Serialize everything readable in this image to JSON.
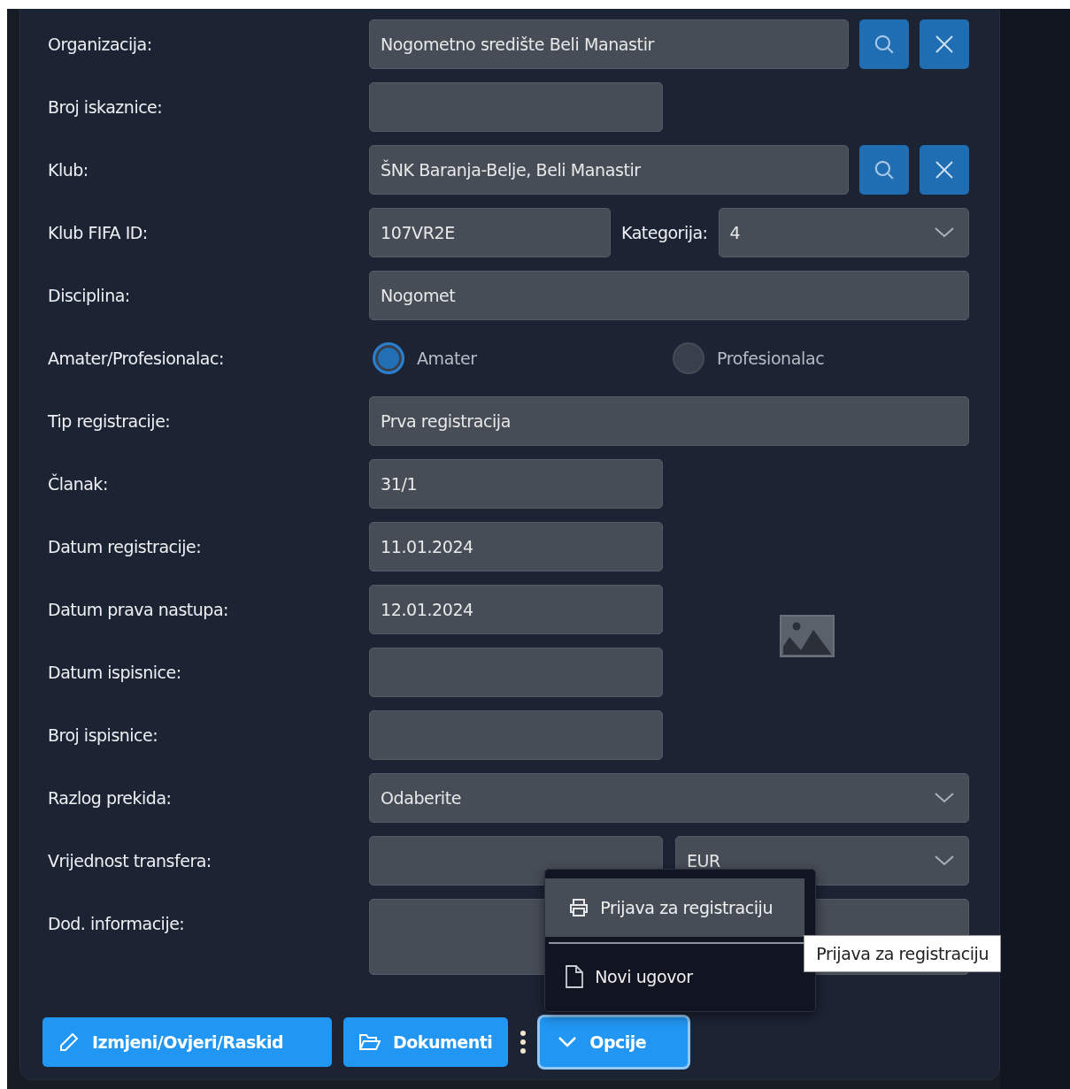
{
  "form": {
    "rows": [
      {
        "label": "Organizacija:",
        "kind": "lookup",
        "value": "Nogometno središte Beli Manastir"
      },
      {
        "label": "Broj iskaznice:",
        "kind": "short",
        "value": ""
      },
      {
        "label": "Klub:",
        "kind": "lookup",
        "value": "ŠNK Baranja-Belje, Beli Manastir"
      },
      {
        "label": "Klub FIFA ID:",
        "kind": "split",
        "value": "107VR2E",
        "second_label": "Kategorija:",
        "second_value": "4"
      },
      {
        "label": "Disciplina:",
        "kind": "wide",
        "value": "Nogomet"
      },
      {
        "label": "Amater/Profesionalac:",
        "kind": "radio",
        "options": [
          {
            "label": "Amater",
            "selected": true
          },
          {
            "label": "Profesionalac",
            "selected": false
          }
        ]
      },
      {
        "label": "Tip registracije:",
        "kind": "wide",
        "value": "Prva registracija"
      },
      {
        "label": "Članak:",
        "kind": "short",
        "value": "31/1"
      },
      {
        "label": "Datum registracije:",
        "kind": "short",
        "value": "11.01.2024"
      },
      {
        "label": "Datum prava nastupa:",
        "kind": "short",
        "value": "12.01.2024"
      },
      {
        "label": "Datum ispisnice:",
        "kind": "short",
        "value": ""
      },
      {
        "label": "Broj ispisnice:",
        "kind": "short",
        "value": ""
      },
      {
        "label": "Razlog prekida:",
        "kind": "select",
        "value": "Odaberite"
      },
      {
        "label": "Vrijednost transfera:",
        "kind": "currency",
        "value": "",
        "currency": "EUR"
      },
      {
        "label": "Dod. informacije:",
        "kind": "textarea",
        "value": ""
      }
    ]
  },
  "buttons": [
    "Izmjeni/Ovjeri/Raskid",
    "Dokumenti"
  ],
  "options_button": {
    "label": "Opcije",
    "expanded": true
  },
  "menu": {
    "items": [
      {
        "label": "Prijava za registraciju",
        "highlighted": true
      },
      {
        "label": "Novi ugovor",
        "highlighted": false
      }
    ]
  },
  "tooltip": "Prijava za registraciju"
}
